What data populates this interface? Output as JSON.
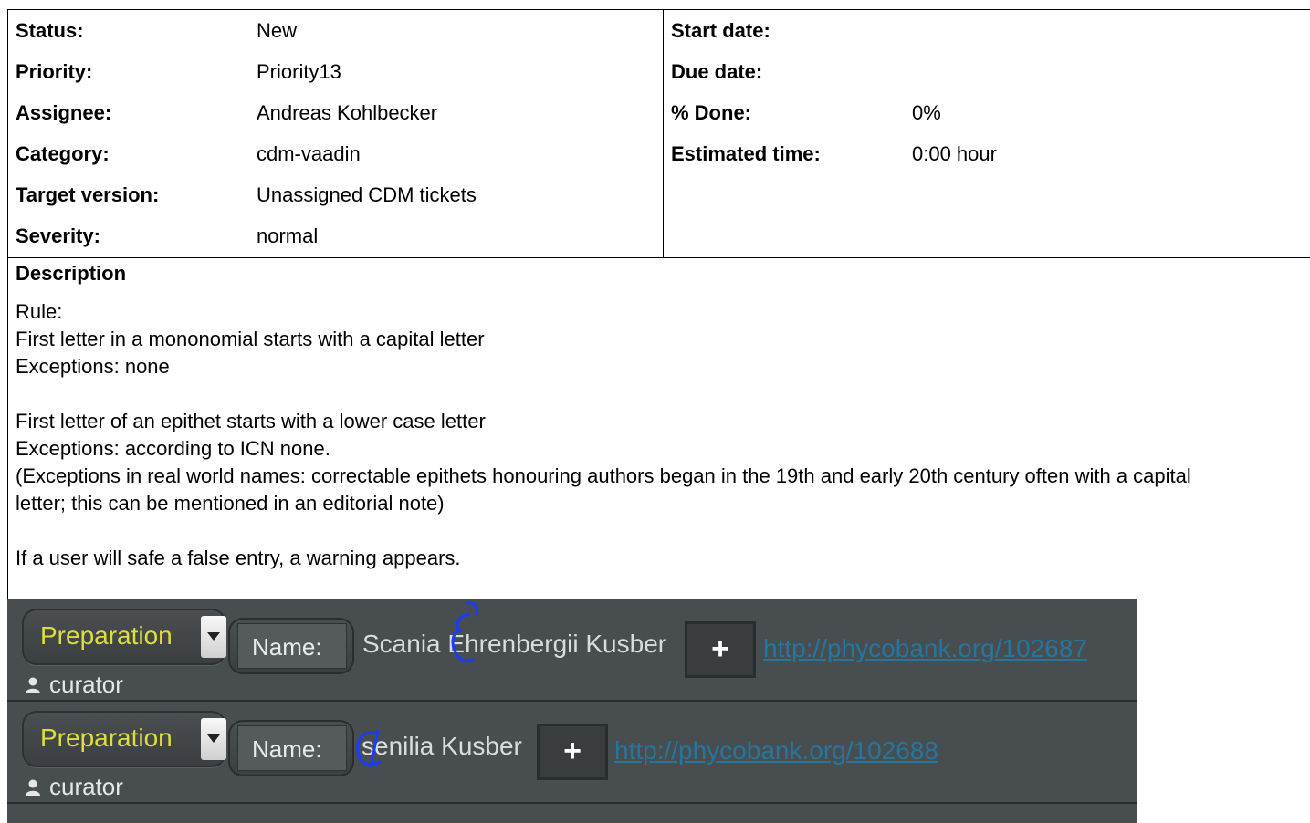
{
  "attributes_left": [
    {
      "label": "Status:",
      "value": "New"
    },
    {
      "label": "Priority:",
      "value": "Priority13"
    },
    {
      "label": "Assignee:",
      "value": "Andreas Kohlbecker"
    },
    {
      "label": "Category:",
      "value": "cdm-vaadin"
    },
    {
      "label": "Target version:",
      "value": "Unassigned CDM tickets"
    },
    {
      "label": "Severity:",
      "value": "normal"
    }
  ],
  "attributes_right": [
    {
      "label": "Start date:",
      "value": ""
    },
    {
      "label": "Due date:",
      "value": ""
    },
    {
      "label": "% Done:",
      "value": "0%"
    },
    {
      "label": "Estimated time:",
      "value": "0:00 hour"
    }
  ],
  "description": {
    "title": "Description",
    "lines": [
      "Rule:",
      "First letter in a mononomial starts with a capital letter",
      "Exceptions: none",
      "",
      "First letter of an epithet starts with a lower case letter",
      "Exceptions: according to ICN none.",
      "(Exceptions in real world names: correctable epithets honouring authors began in the 19th and early 20th century often with a capital",
      "letter; this can be mentioned in an editorial note)",
      "",
      "If a user will safe a false entry, a warning appears."
    ]
  },
  "screenshot": {
    "rows": [
      {
        "status": "Preparation",
        "name_label": "Name:",
        "name": "Scania Ehrenbergii Kusber",
        "add": "+",
        "link": "http://phycobank.org/102687",
        "user": "curator"
      },
      {
        "status": "Preparation",
        "name_label": "Name:",
        "name": "senilia Kusber",
        "add": "+",
        "link": "http://phycobank.org/102688",
        "user": "curator"
      }
    ]
  },
  "colors": {
    "status_yellow": "#dede3a",
    "link_blue": "#25769e",
    "panel_bg": "#484d50",
    "annotation_blue": "#1a3cff"
  }
}
